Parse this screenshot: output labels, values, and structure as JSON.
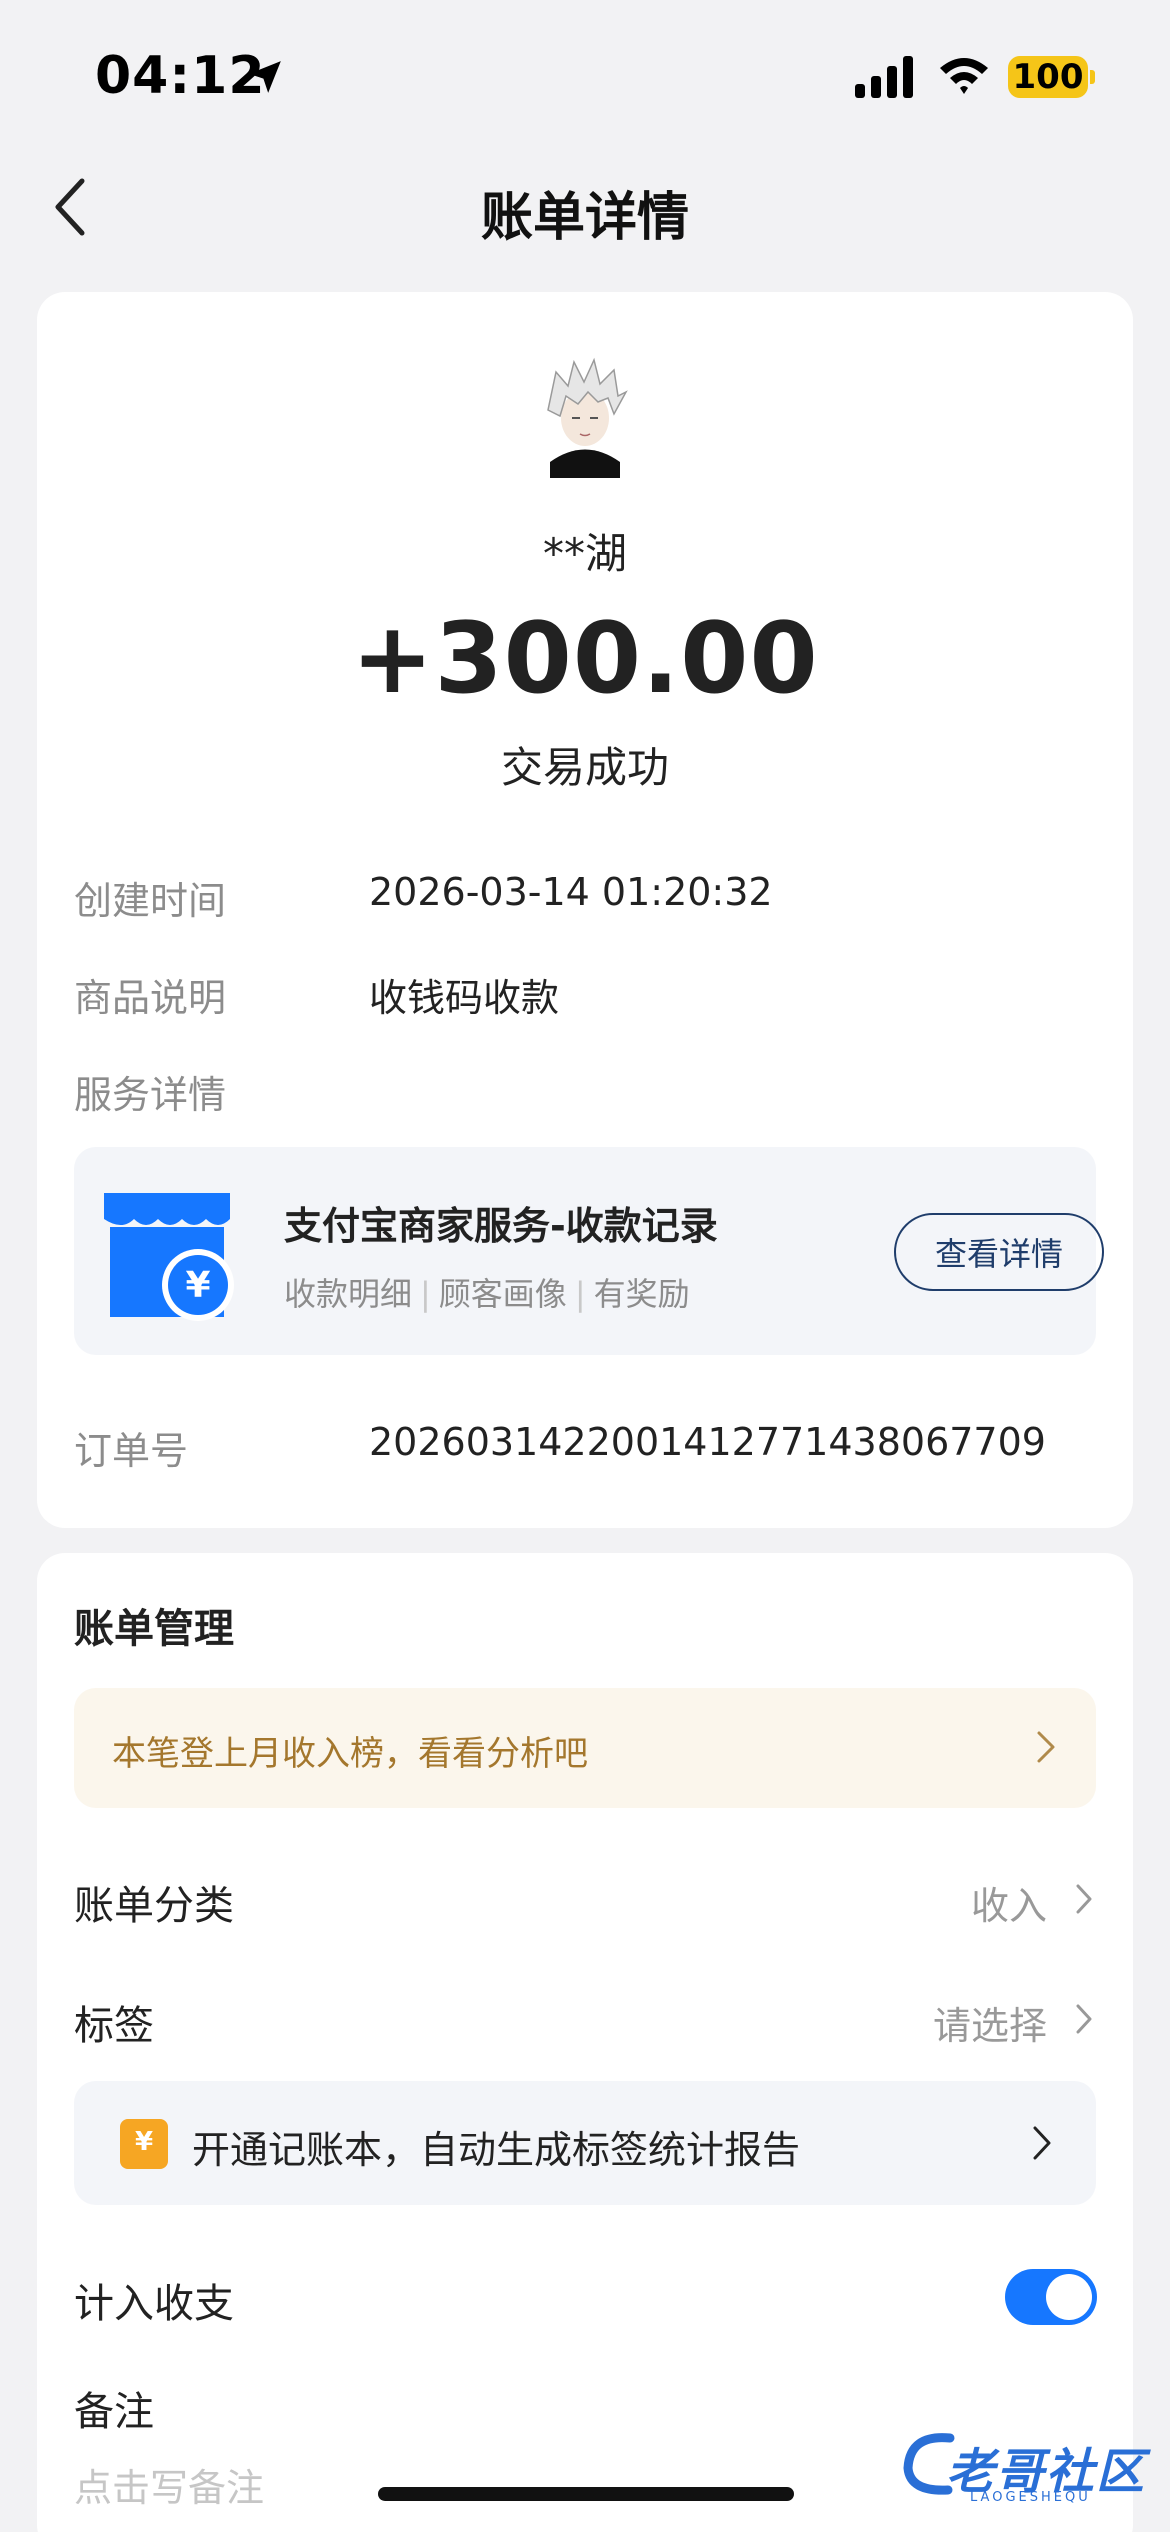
{
  "status_bar": {
    "time": "04:12",
    "battery": "100"
  },
  "nav": {
    "title": "账单详情"
  },
  "transaction": {
    "payer_name": "**湖",
    "amount": "+300.00",
    "status": "交易成功"
  },
  "details": {
    "created_label": "创建时间",
    "created_value": "2026-03-14 01:20:32",
    "product_label": "商品说明",
    "product_value": "收钱码收款",
    "service_label": "服务详情",
    "order_label": "订单号",
    "order_value": "2026031422001412771438067709"
  },
  "service": {
    "title": "支付宝商家服务-收款记录",
    "tags": [
      "收款明细",
      "顾客画像",
      "有奖励"
    ],
    "button": "查看详情"
  },
  "management": {
    "title": "账单管理",
    "promo": "本笔登上月收入榜，看看分析吧",
    "category_label": "账单分类",
    "category_value": "收入",
    "tag_label": "标签",
    "tag_value": "请选择",
    "ledger_text": "开通记账本，自动生成标签统计报告",
    "ledger_icon_glyph": "¥",
    "include_label": "计入收支",
    "include_on": true,
    "remark_label": "备注",
    "remark_placeholder": "点击写备注"
  },
  "watermark": {
    "text": "老哥社区",
    "sub": "LAOGESHEQU"
  },
  "colors": {
    "accent": "#1677ff",
    "promo_text": "#a4772d",
    "button_border": "#1f3d6b"
  }
}
